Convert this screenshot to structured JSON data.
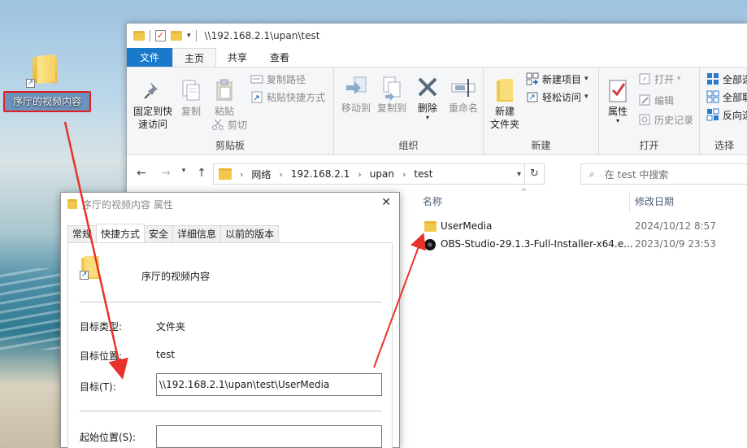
{
  "desktop": {
    "shortcut_label": "序厅的视频内容"
  },
  "explorer": {
    "title": "\\\\192.168.2.1\\upan\\test",
    "tabs": [
      "文件",
      "主页",
      "共享",
      "查看"
    ],
    "ribbon": {
      "clipboard": {
        "pin_line1": "固定到快",
        "pin_line2": "速访问",
        "copy": "复制",
        "paste": "粘贴",
        "copy_path": "复制路径",
        "paste_shortcut": "粘贴快捷方式",
        "cut": "剪切",
        "group": "剪贴板"
      },
      "organize": {
        "move_to": "移动到",
        "copy_to": "复制到",
        "delete": "删除",
        "rename": "重命名",
        "group": "组织"
      },
      "new": {
        "new_folder_line1": "新建",
        "new_folder_line2": "文件夹",
        "new_item": "新建项目",
        "easy_access": "轻松访问",
        "group": "新建"
      },
      "open": {
        "properties": "属性",
        "open": "打开",
        "edit": "编辑",
        "history": "历史记录",
        "group": "打开"
      },
      "select": {
        "select_all": "全部选",
        "select_none": "全部取",
        "invert": "反向选",
        "group": "选择"
      }
    },
    "address": [
      "网络",
      "192.168.2.1",
      "upan",
      "test"
    ],
    "search_placeholder": "在 test 中搜索",
    "columns": {
      "name": "名称",
      "modified": "修改日期"
    },
    "files": [
      {
        "name": "UserMedia",
        "date": "2024/10/12 8:57",
        "icon": "folder-icon"
      },
      {
        "name": "OBS-Studio-29.1.3-Full-Installer-x64.e...",
        "date": "2023/10/9 23:53",
        "icon": "obs-app-icon"
      }
    ]
  },
  "dialog": {
    "title": "序厅的视频内容 属性",
    "tabs": [
      "常规",
      "快捷方式",
      "安全",
      "详细信息",
      "以前的版本"
    ],
    "shortcut_name": "序厅的视频内容",
    "target_type_label": "目标类型:",
    "target_type_value": "文件夹",
    "target_location_label": "目标位置:",
    "target_location_value": "test",
    "target_label": "目标(T):",
    "target_value": "\\\\192.168.2.1\\upan\\test\\UserMedia",
    "start_in_label": "起始位置(S):",
    "start_in_value": ""
  },
  "colors": {
    "file_tab": "#1979ca",
    "highlight_border": "#e02020",
    "annotation_arrow": "#e8322b"
  }
}
